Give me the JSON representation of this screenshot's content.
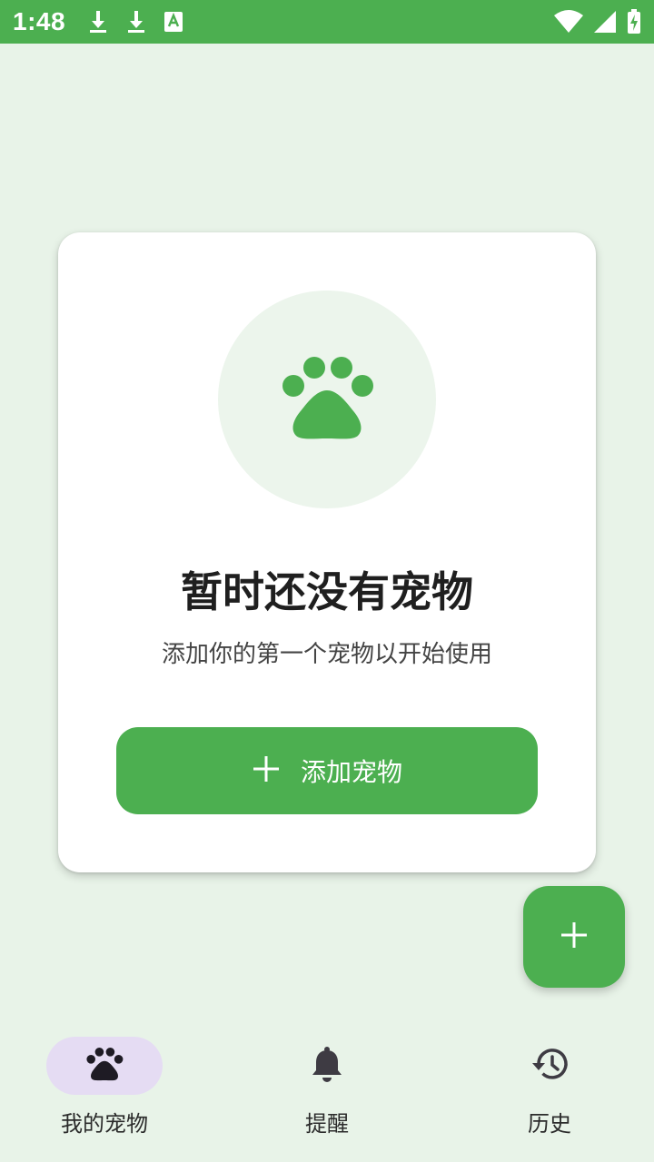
{
  "status_bar": {
    "time": "1:48",
    "icons_left": [
      "download-icon",
      "download-icon",
      "text-icon"
    ],
    "icons_right": [
      "wifi-icon",
      "signal-icon",
      "battery-icon"
    ]
  },
  "empty_state": {
    "icon": "paw-icon",
    "title": "暂时还没有宠物",
    "subtitle": "添加你的第一个宠物以开始使用",
    "button_label": "添加宠物"
  },
  "fab": {
    "icon": "plus-icon"
  },
  "bottom_nav": {
    "items": [
      {
        "label": "我的宠物",
        "icon": "paw-icon",
        "active": true
      },
      {
        "label": "提醒",
        "icon": "bell-icon",
        "active": false
      },
      {
        "label": "历史",
        "icon": "history-icon",
        "active": false
      }
    ]
  },
  "colors": {
    "primary": "#4CAF50",
    "background": "#E8F3E8",
    "card": "#FFFFFF",
    "paw_circle": "#ECF5EC",
    "nav_active_pill": "#E5DCF3"
  }
}
